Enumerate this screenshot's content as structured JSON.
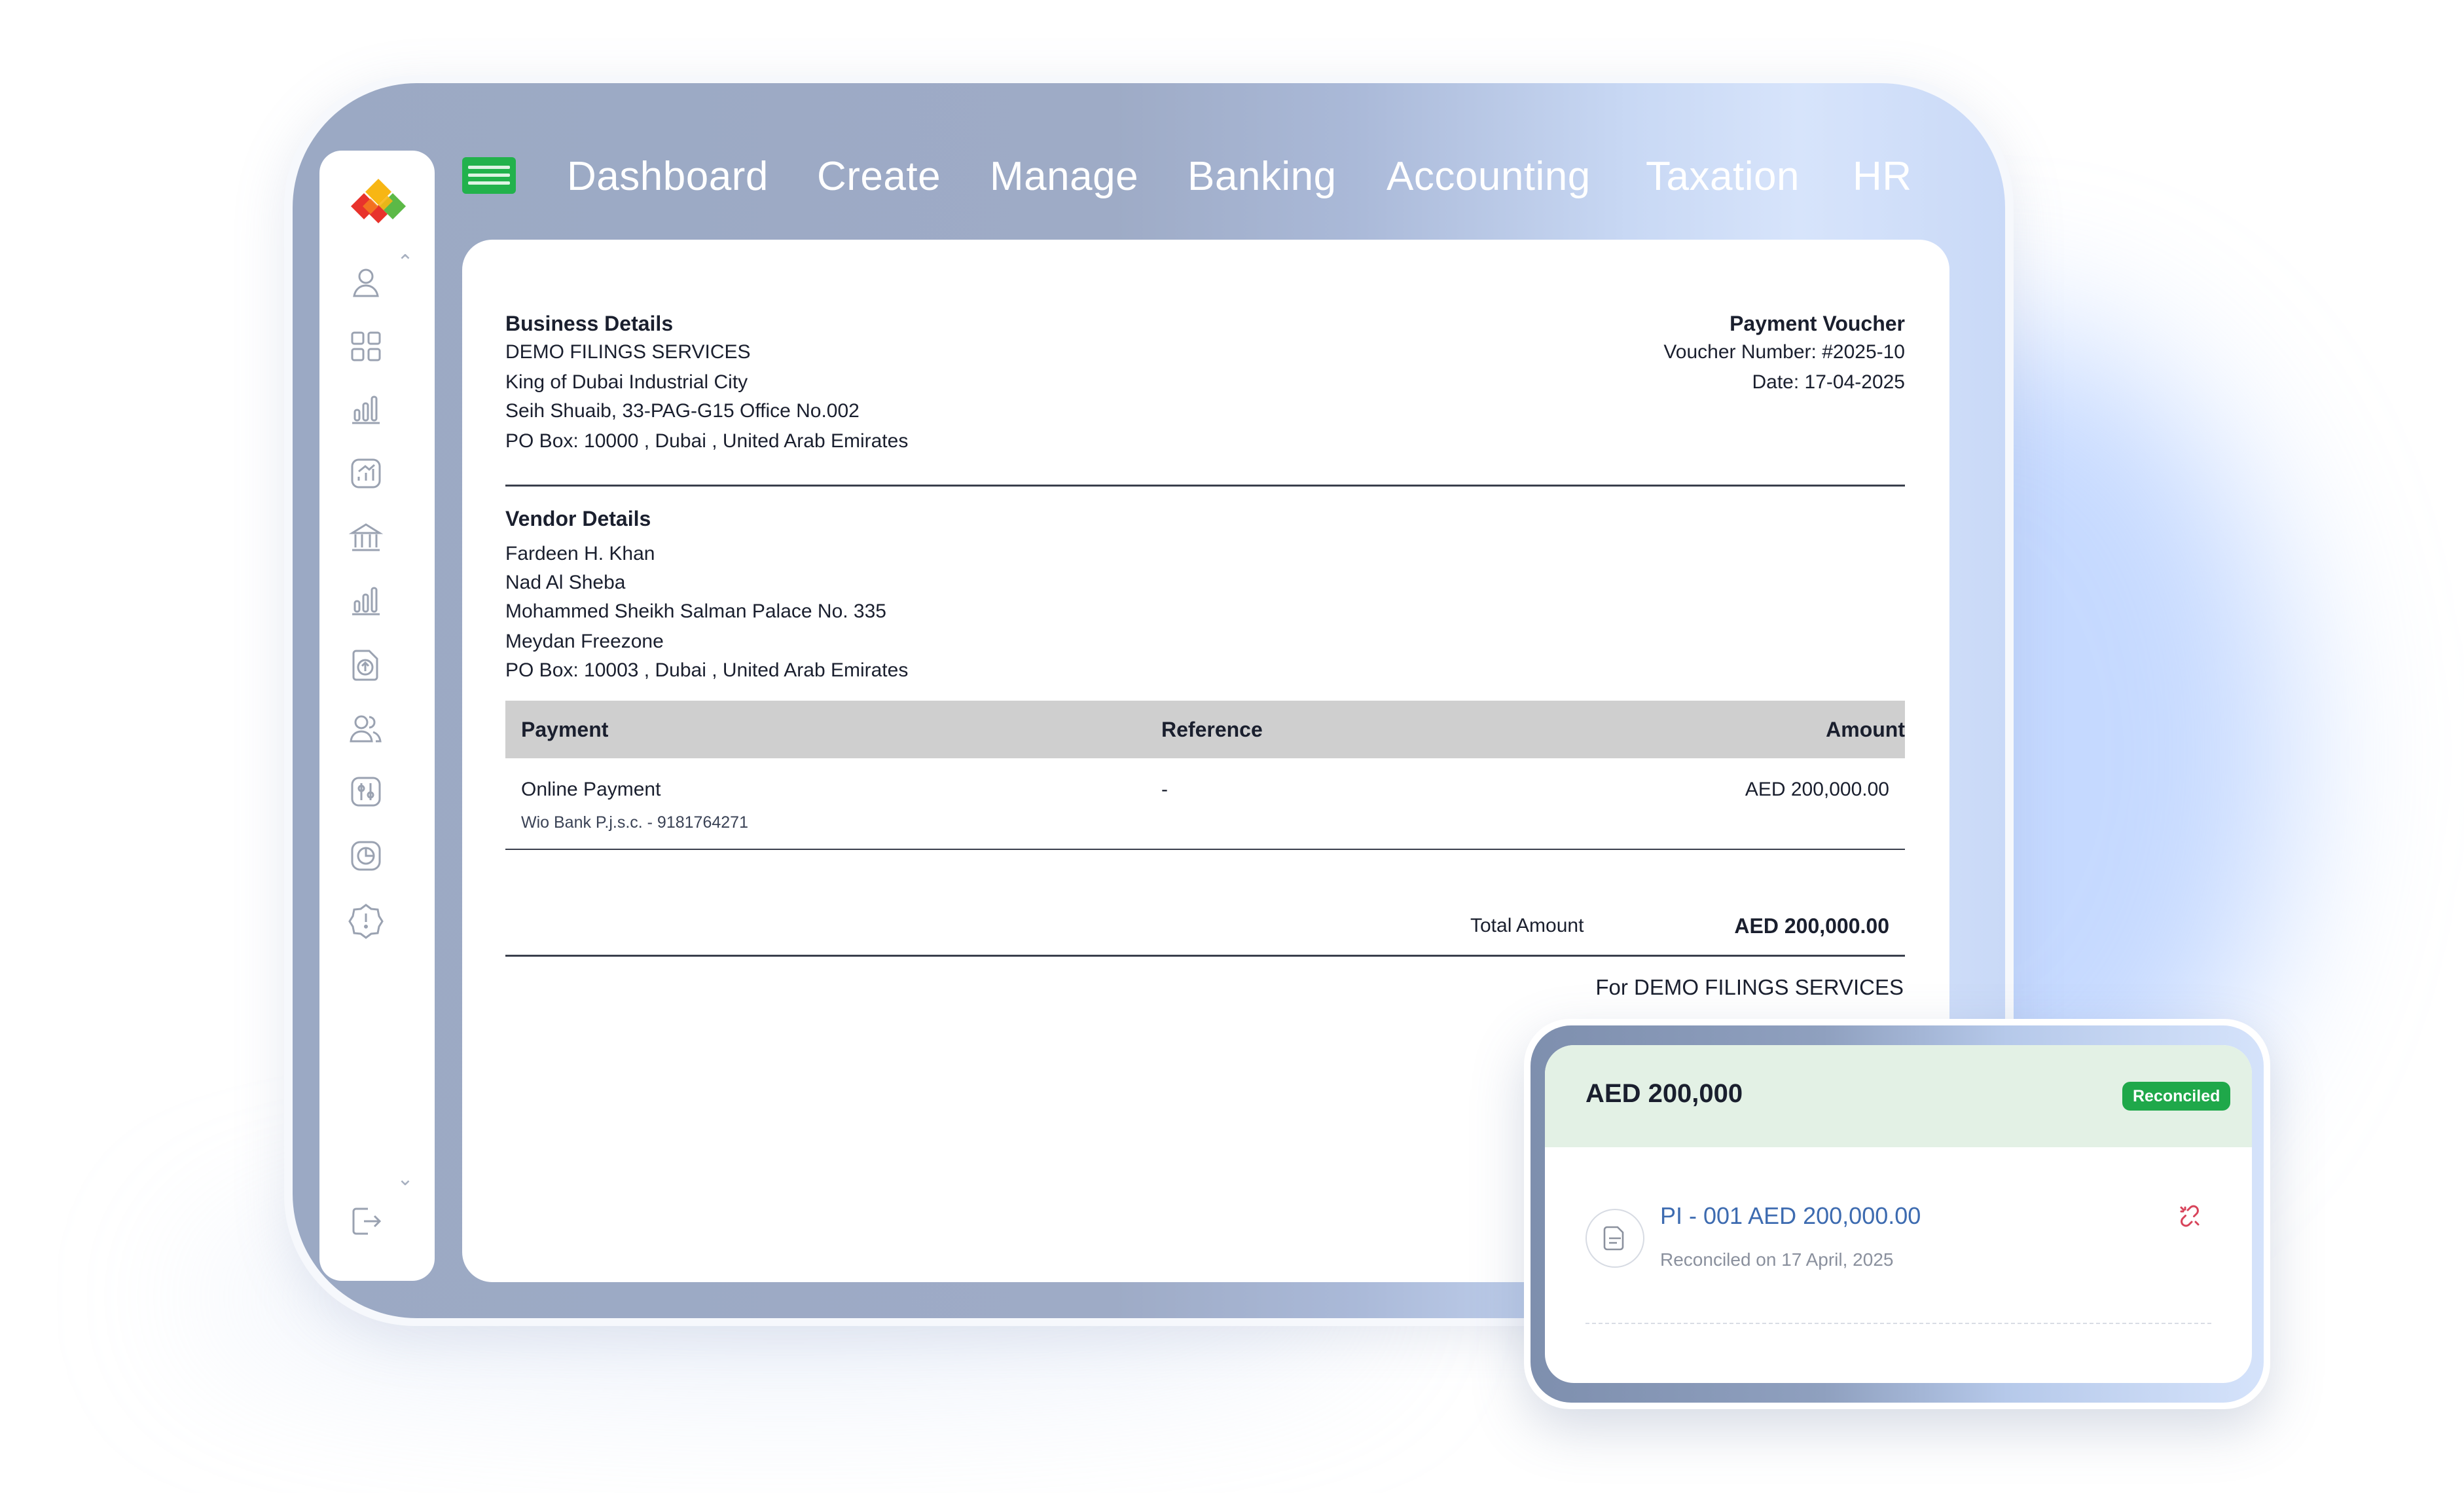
{
  "nav": {
    "items": [
      "Dashboard",
      "Create",
      "Manage",
      "Banking",
      "Accounting",
      "Taxation",
      "HR"
    ]
  },
  "sidebar": {
    "icons": [
      "user-icon",
      "grid-icon",
      "bar-chart-icon",
      "analytics-icon",
      "bank-icon",
      "bar-chart-icon",
      "upload-icon",
      "users-icon",
      "settings-icon",
      "pie-chart-icon",
      "alert-icon"
    ],
    "logout_icon": "logout-icon"
  },
  "document": {
    "business": {
      "heading": "Business Details",
      "name": "DEMO FILINGS SERVICES",
      "line1": "King of Dubai Industrial City",
      "line2": "Seih Shuaib, 33-PAG-G15 Office No.002",
      "line3": "PO Box: 10000 , Dubai , United Arab Emirates"
    },
    "voucher": {
      "title": "Payment Voucher",
      "number": "Voucher Number: #2025-10",
      "date": "Date: 17-04-2025"
    },
    "vendor": {
      "heading": "Vendor Details",
      "name": "Fardeen H. Khan",
      "line1": "Nad Al Sheba",
      "line2": "Mohammed Sheikh Salman Palace No. 335",
      "line3": "Meydan Freezone",
      "line4": "PO Box: 10003 , Dubai , United Arab Emirates"
    },
    "table": {
      "headers": {
        "payment": "Payment",
        "reference": "Reference",
        "amount": "Amount"
      },
      "row": {
        "payment": "Online Payment",
        "bank": "Wio Bank P.j.s.c. - 9181764271",
        "reference": "-",
        "amount": "AED 200,000.00"
      }
    },
    "total": {
      "label": "Total Amount",
      "value": "AED 200,000.00"
    },
    "signature": "For DEMO FILINGS SERVICES"
  },
  "reconciliation": {
    "amount": "AED 200,000",
    "status": "Reconciled",
    "invoice": "PI - 001 AED 200,000.00",
    "note": "Reconciled on 17 April, 2025"
  },
  "colors": {
    "accent_green": "#1fa84a",
    "link_blue": "#3d6bb0",
    "unlink_red": "#d8435a",
    "menu_green": "#22b24c"
  }
}
